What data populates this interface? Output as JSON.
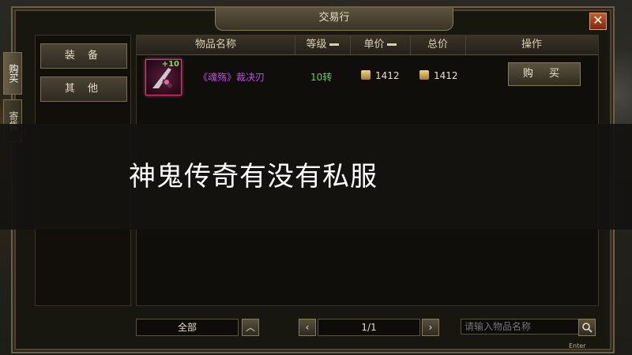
{
  "window": {
    "title": "交易行",
    "close_label": "✕"
  },
  "side_tabs": [
    {
      "label": "购买",
      "active": true
    },
    {
      "label": "寄售",
      "active": false
    }
  ],
  "categories": [
    {
      "label": "装 备"
    },
    {
      "label": "其 他"
    }
  ],
  "table": {
    "columns": [
      "物品名称",
      "等级",
      "单价",
      "总价",
      "操作"
    ],
    "rows": [
      {
        "item_level_badge": "+10",
        "name": "《魂殇》裁决刃",
        "level": "10转",
        "unit_price": "1412",
        "total_price": "1412",
        "action_label": "购 买"
      }
    ]
  },
  "banner": {
    "text": "神鬼传奇有没有私服"
  },
  "bottom": {
    "filter_value": "全部",
    "page_indicator": "1/1",
    "search_placeholder": "请输入物品名称",
    "enter_hint": "Enter"
  },
  "colors": {
    "item_name": "#c24cf0",
    "level": "#62d24a",
    "price": "#e8e0c8"
  }
}
